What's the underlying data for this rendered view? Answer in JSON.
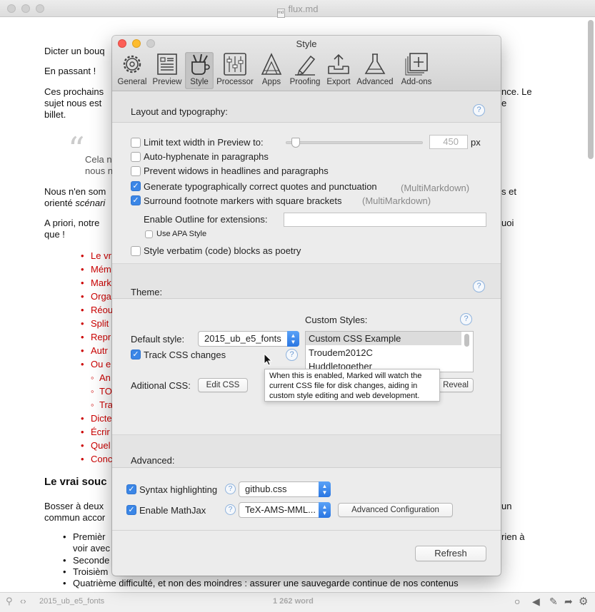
{
  "window": {
    "title": "flux.md"
  },
  "doc": {
    "p1": "Dicter un bouq",
    "p2": "En passant !",
    "p3a": "Ces prochains",
    "p3b": "sujet nous est",
    "p3c": "billet.",
    "p3_right_a": "nce. Le",
    "p3_right_b": "e",
    "quote_a": "Cela n",
    "quote_b": "nous n",
    "p4a": "Nous n'en som",
    "p4b": "orienté ",
    "p4b_italic": "scénari",
    "p4_right": "s et",
    "p5a": "A priori, notre",
    "p5b": "que !",
    "p5_right": "uoi",
    "list": [
      "Le vr",
      "Mém",
      "Mark",
      "Orga",
      "Réou",
      "Split",
      "Repr",
      "Autr",
      "Ou e"
    ],
    "sublist": [
      "An",
      "TO",
      "Tra"
    ],
    "list2": [
      "Dicte",
      "Écrir",
      "Quel",
      "Conc"
    ],
    "heading": "Le vrai souc",
    "p6a": "Bosser à deux",
    "p6b": "commun accor",
    "p6_right": "un",
    "bullets": [
      "Premièr",
      "voir avec",
      "Seconde",
      "Troisièm",
      "Quatrième difficulté, et non des moindres : assurer une sauvegarde continue de nos contenus"
    ],
    "bullet_right": "rien à"
  },
  "statusbar": {
    "style_name": "2015_ub_e5_fonts",
    "word_count": "1 262 word"
  },
  "dialog": {
    "title": "Style",
    "toolbar": [
      {
        "label": "General",
        "icon": "gear-icon"
      },
      {
        "label": "Preview",
        "icon": "preview-icon"
      },
      {
        "label": "Style",
        "icon": "style-icon"
      },
      {
        "label": "Processor",
        "icon": "processor-icon"
      },
      {
        "label": "Apps",
        "icon": "apps-icon"
      },
      {
        "label": "Proofing",
        "icon": "proofing-icon"
      },
      {
        "label": "Export",
        "icon": "export-icon"
      },
      {
        "label": "Advanced",
        "icon": "advanced-icon"
      },
      {
        "label": "Add-ons",
        "icon": "addons-icon"
      }
    ],
    "layout": {
      "heading": "Layout and typography:",
      "limit_width": "Limit text width in Preview to:",
      "width_value": "450",
      "width_unit": "px",
      "auto_hyphenate": "Auto-hyphenate in paragraphs",
      "prevent_widows": "Prevent widows in headlines and paragraphs",
      "typographic_quotes": "Generate typographically correct quotes and punctuation",
      "typographic_tag": "(MultiMarkdown)",
      "footnote_brackets": "Surround footnote markers with square brackets",
      "footnote_tag": "(MultiMarkdown)",
      "outline_label": "Enable Outline for extensions:",
      "outline_value": "",
      "apa_style": "Use APA Style",
      "verbatim_poetry": "Style verbatim (code) blocks as poetry"
    },
    "theme": {
      "heading": "Theme:",
      "custom_styles_label": "Custom Styles:",
      "custom_styles": [
        "Custom CSS Example",
        "Troudem2012C",
        "Huddletogether"
      ],
      "default_style_label": "Default style:",
      "default_style_value": "2015_ub_e5_fonts",
      "track_css": "Track CSS changes",
      "additional_css_label": "Aditional CSS:",
      "edit_css": "Edit CSS",
      "reveal": "Reveal",
      "tooltip": "When this is enabled, Marked will watch the current CSS file for disk changes, aiding in custom style editing and web development."
    },
    "advanced": {
      "heading": "Advanced:",
      "syntax_highlighting": "Syntax highlighting",
      "syntax_theme": "github.css",
      "enable_mathjax": "Enable MathJax",
      "mathjax_config": "TeX-AMS-MML...",
      "advanced_config": "Advanced Configuration",
      "refresh": "Refresh"
    }
  },
  "colors": {
    "checkbox_on": "#3b86e6",
    "red_text": "#cc0000",
    "help": "#6c9ad2"
  }
}
